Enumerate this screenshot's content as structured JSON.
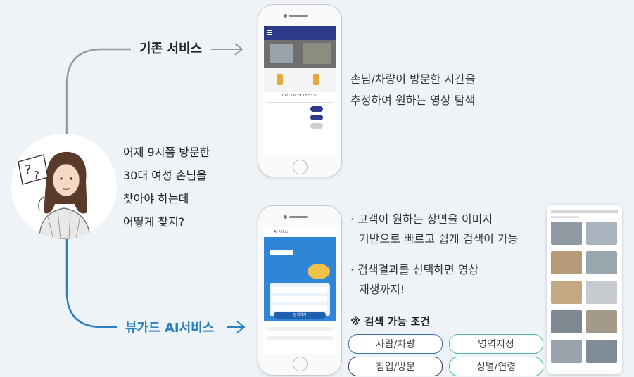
{
  "flow": {
    "existing_label": "기존 서비스",
    "ai_label": "뷰가드 AI서비스"
  },
  "question": {
    "lines": [
      "어제 9시쯤 방문한",
      "30대 여성 손님을",
      "찾아야 하는데",
      "어떻게 찾지?"
    ]
  },
  "existing": {
    "desc_lines": [
      "손님/차량이 방문한 시간을",
      "추정하여 원하는 영상 탐색"
    ],
    "phone_date": "2021.06.29  13:53:51"
  },
  "ai": {
    "bullets": [
      {
        "line1": "· 고객이 원하는 장면을 이미지",
        "line2": "기반으로 빠르고 쉽게 검색이 가능"
      },
      {
        "line1": "· 검색결과를 선택하면 영상",
        "line2": "재생까지!"
      }
    ],
    "conditions_title": "※ 검색 가능 조건",
    "conditions": [
      "사람/차량",
      "영역지정",
      "침입/방문",
      "성별/연령"
    ],
    "phone_header": "AI 서비스",
    "phone_search_btn": "검색하기"
  },
  "colors": {
    "accent_blue": "#2a7fbf",
    "chip_blue": "#3b6fb0",
    "chip_teal": "#4fb3a7",
    "chip_navy": "#3a3a5a",
    "background": "#eef3f8"
  }
}
